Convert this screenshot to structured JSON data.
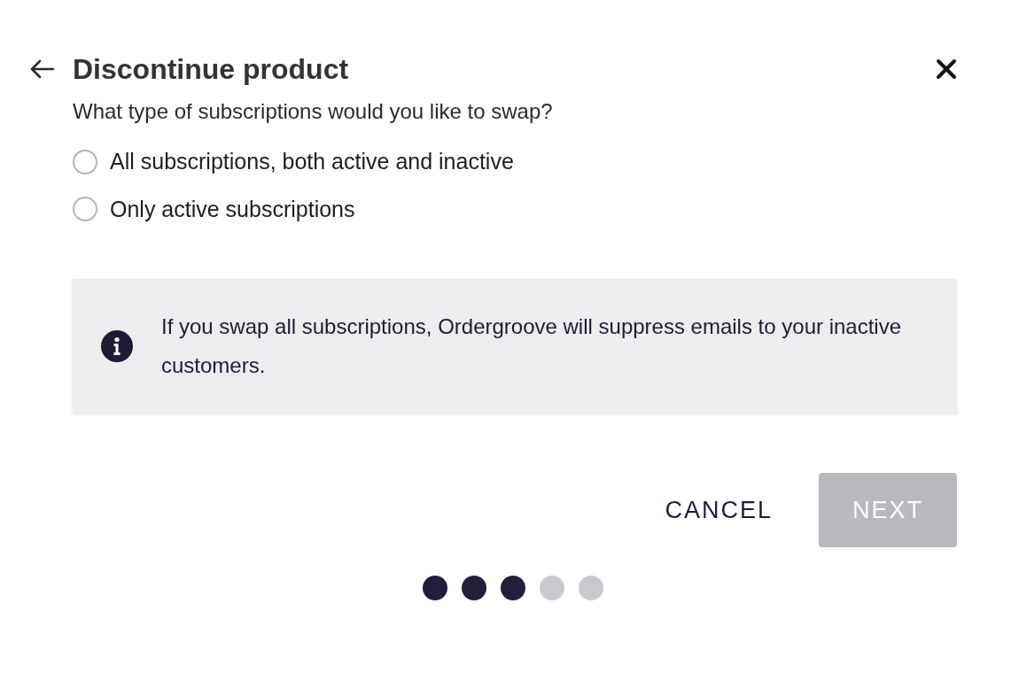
{
  "dialog": {
    "title": "Discontinue product",
    "question": "What type of subscriptions would you like to swap?"
  },
  "options": [
    {
      "label": "All subscriptions, both active and inactive",
      "selected": false
    },
    {
      "label": "Only active subscriptions",
      "selected": false
    }
  ],
  "info": {
    "text": "If you swap all subscriptions, Ordergroove will suppress emails to your inactive customers."
  },
  "buttons": [
    {
      "label": "CANCEL",
      "kind": "text",
      "disabled": false
    },
    {
      "label": "NEXT",
      "kind": "primary",
      "disabled": true
    }
  ],
  "steps": [
    {
      "completed": true
    },
    {
      "completed": true
    },
    {
      "completed": true
    },
    {
      "completed": false
    },
    {
      "completed": false
    }
  ]
}
